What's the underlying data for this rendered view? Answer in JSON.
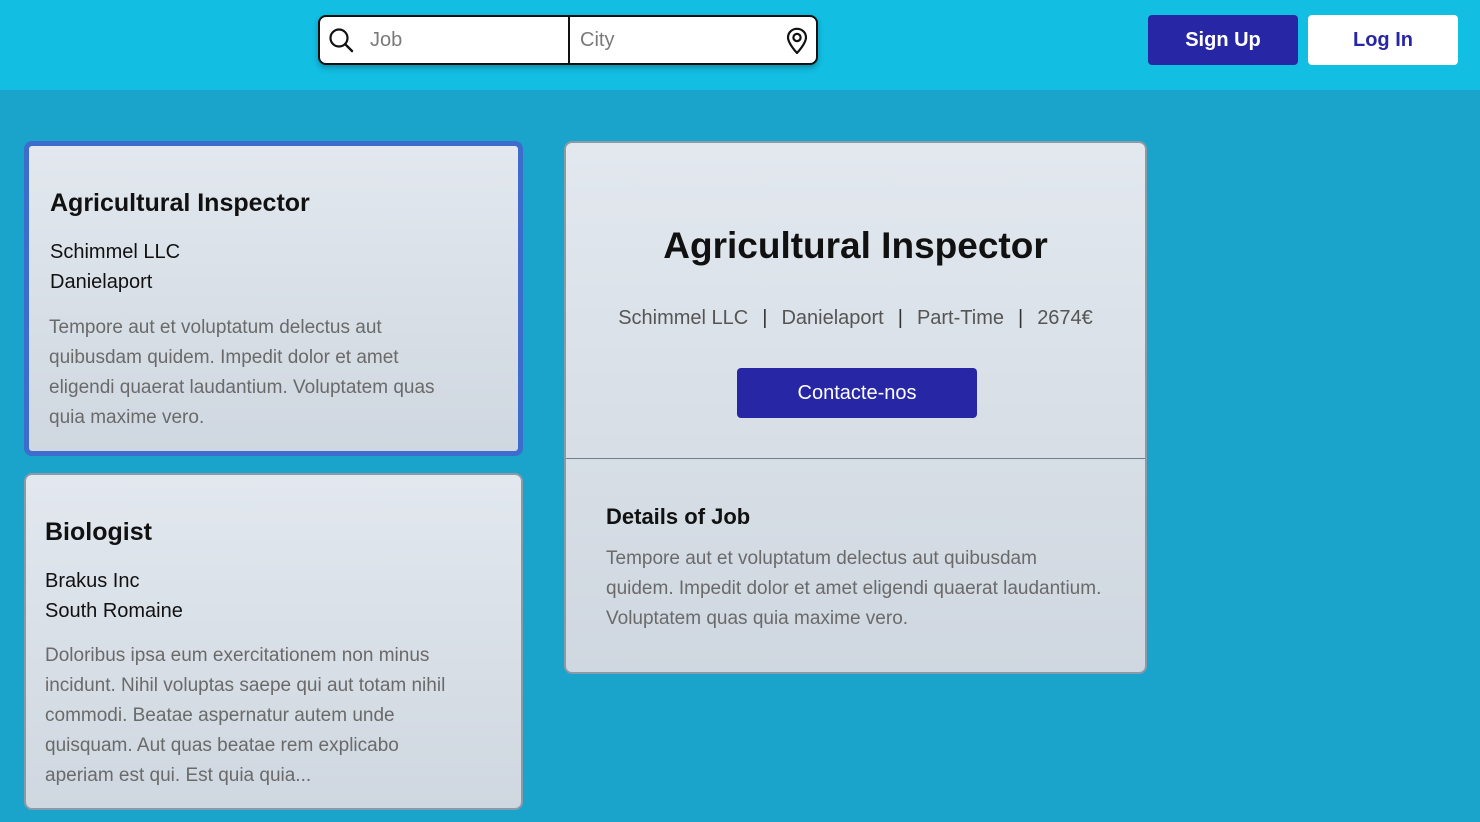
{
  "colors": {
    "topbar_bg": "#12bee2",
    "page_bg": "#1aa3cb",
    "primary": "#2727a6",
    "selected_border": "#3d6ccc"
  },
  "search": {
    "job_placeholder": "Job",
    "job_value": "",
    "city_placeholder": "City",
    "city_value": "",
    "search_icon": "search-icon",
    "location_icon": "location-pin-icon"
  },
  "auth": {
    "signup_label": "Sign Up",
    "login_label": "Log In"
  },
  "jobs": [
    {
      "title": "Agricultural Inspector",
      "company": "Schimmel LLC",
      "city": "Danielaport",
      "description": "Tempore aut et voluptatum delectus aut quibusdam quidem. Impedit dolor et amet eligendi quaerat laudantium. Voluptatem quas quia maxime vero.",
      "selected": true
    },
    {
      "title": "Biologist",
      "company": "Brakus Inc",
      "city": "South Romaine",
      "description": "Doloribus ipsa eum exercitationem non minus incidunt. Nihil voluptas saepe qui aut totam nihil commodi. Beatae aspernatur autem unde quisquam. Aut quas beatae rem explicabo aperiam est qui. Est quia quia...",
      "selected": false
    }
  ],
  "detail": {
    "title": "Agricultural Inspector",
    "company": "Schimmel LLC",
    "city": "Danielaport",
    "type": "Part-Time",
    "salary": "2674€",
    "separator": "|",
    "contact_label": "Contacte-nos",
    "details_heading": "Details of Job",
    "details_text": "Tempore aut et voluptatum delectus aut quibusdam quidem. Impedit dolor et amet eligendi quaerat laudantium. Voluptatem quas quia maxime vero."
  }
}
